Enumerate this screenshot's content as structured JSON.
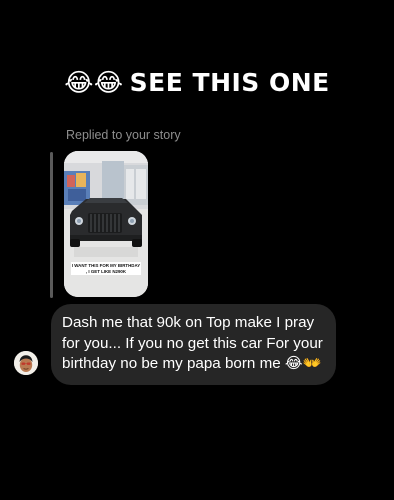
{
  "caption": {
    "emojis": "😂😂",
    "text": "SEE THIS ONE"
  },
  "reply": {
    "label": "Replied to your story",
    "story_text": "I WANT THIS FOR MY BIRTHDAY , I GET LIKE N290K"
  },
  "message": {
    "text": "Dash me that 90k on Top make I pray for you... If you no get this car For your birthday no be my papa born me 😂👐"
  },
  "colors": {
    "background": "#000000",
    "bubble": "#262626",
    "secondary_text": "#8e8e8e",
    "reply_bar": "#5a5a5a"
  },
  "icons": {
    "avatar": "memoji-avatar-icon",
    "story_image": "car-showroom-image"
  }
}
